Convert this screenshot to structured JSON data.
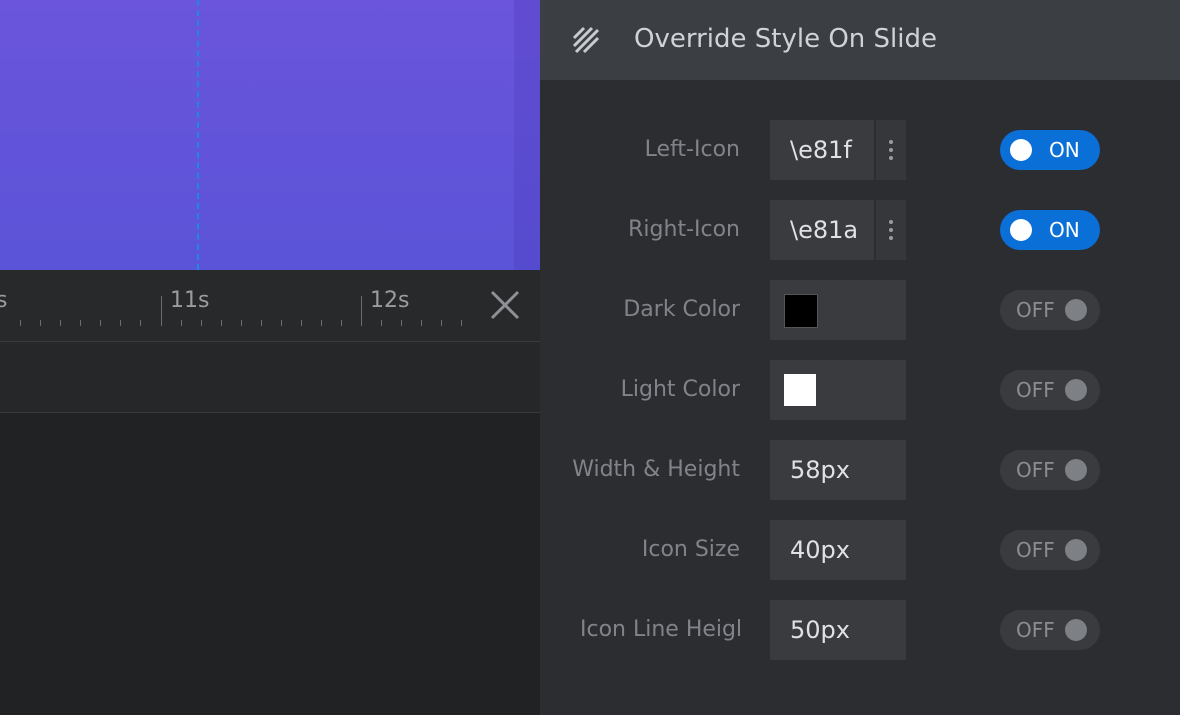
{
  "timeline": {
    "ticks": [
      "s",
      "11s",
      "12s"
    ]
  },
  "panel": {
    "title": "Override Style On Slide",
    "rows": [
      {
        "label": "Left-Icon",
        "value": "\\e81f",
        "toggle": "ON"
      },
      {
        "label": "Right-Icon",
        "value": "\\e81a",
        "toggle": "ON"
      },
      {
        "label": "Dark Color",
        "color": "#000000",
        "toggle": "OFF"
      },
      {
        "label": "Light Color",
        "color": "#ffffff",
        "toggle": "OFF"
      },
      {
        "label": "Width & Height",
        "value": "58px",
        "toggle": "OFF"
      },
      {
        "label": "Icon Size",
        "value": "40px",
        "toggle": "OFF"
      },
      {
        "label": "Icon Line Height",
        "value": "50px",
        "toggle": "OFF"
      }
    ]
  },
  "colors": {
    "canvas": "#6355da",
    "accent": "#0a6fd6",
    "panel_bg": "#2c2d30"
  }
}
